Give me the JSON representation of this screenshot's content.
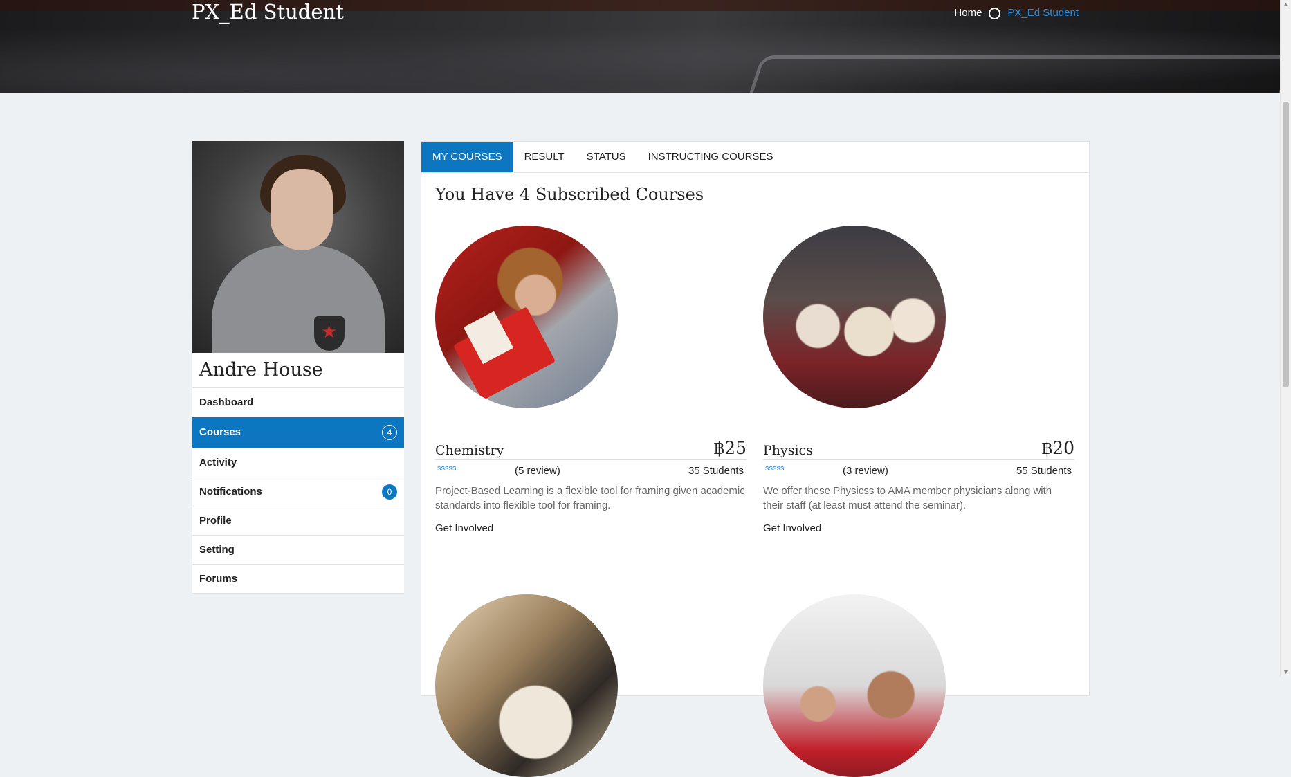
{
  "header": {
    "title": "PX_Ed Student",
    "breadcrumb": {
      "home": "Home",
      "current": "PX_Ed Student"
    }
  },
  "profile": {
    "name": "Andre House"
  },
  "sidebar": {
    "items": [
      {
        "label": "Dashboard",
        "count": null,
        "active": false
      },
      {
        "label": "Courses",
        "count": "4",
        "active": true
      },
      {
        "label": "Activity",
        "count": null,
        "active": false
      },
      {
        "label": "Notifications",
        "count": "0",
        "active": false
      },
      {
        "label": "Profile",
        "count": null,
        "active": false
      },
      {
        "label": "Setting",
        "count": null,
        "active": false
      },
      {
        "label": "Forums",
        "count": null,
        "active": false
      }
    ]
  },
  "tabs": [
    {
      "label": "MY COURSES",
      "active": true
    },
    {
      "label": "RESULT",
      "active": false
    },
    {
      "label": "STATUS",
      "active": false
    },
    {
      "label": "INSTRUCTING COURSES",
      "active": false
    }
  ],
  "main": {
    "heading": "You Have 4 Subscribed Courses",
    "courses": [
      {
        "name": "Chemistry",
        "price": "฿25",
        "stars": "sssss",
        "reviews": "(5 review)",
        "students": "35 Students",
        "description": "Project-Based Learning is a flexible tool for framing given academic standards into flexible tool for framing.",
        "link": "Get Involved"
      },
      {
        "name": "Physics",
        "price": "฿20",
        "stars": "sssss",
        "reviews": "(3 review)",
        "students": "55 Students",
        "description": "We offer these Physicss to AMA member physicians along with their staff (at least must attend the seminar).",
        "link": "Get Involved"
      }
    ]
  },
  "colors": {
    "accent": "#0d76c0",
    "link": "#2b8ad8",
    "background": "#eef1f4"
  }
}
